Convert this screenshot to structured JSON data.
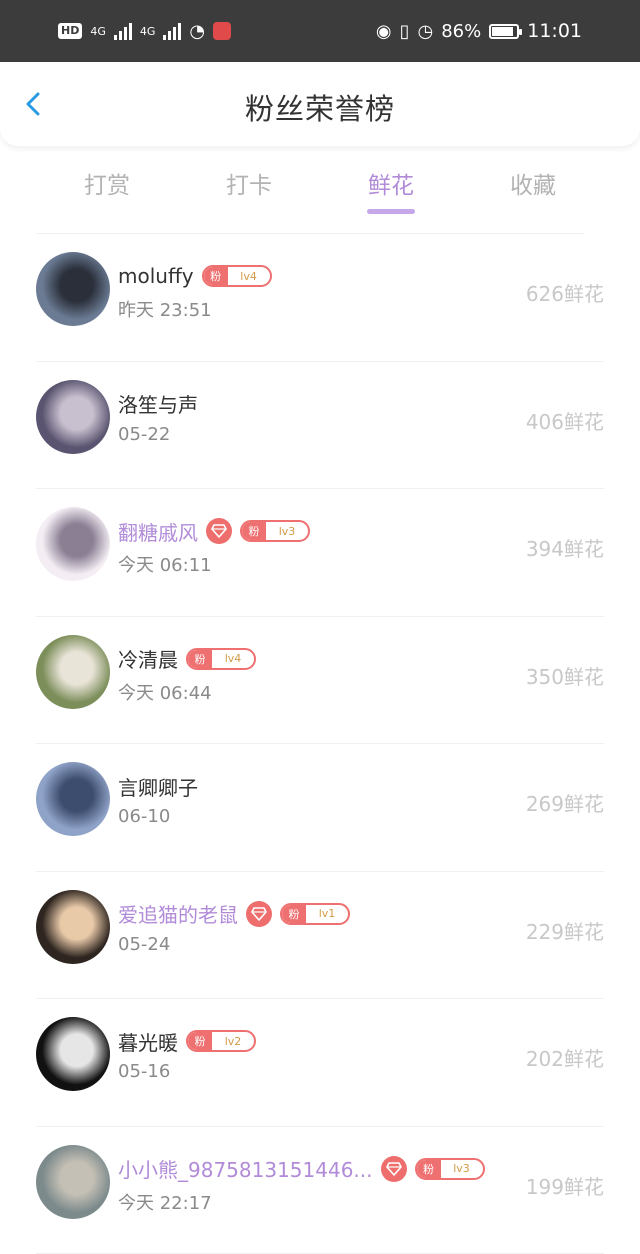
{
  "status_bar": {
    "hd": "HD",
    "net1": "4G",
    "net2": "4G",
    "battery": "86%",
    "time": "11:01"
  },
  "header": {
    "title": "粉丝荣誉榜"
  },
  "tabs": [
    {
      "label": "打赏",
      "active": false
    },
    {
      "label": "打卡",
      "active": false
    },
    {
      "label": "鲜花",
      "active": true
    },
    {
      "label": "收藏",
      "active": false
    }
  ],
  "fans_list": [
    {
      "name": "moluffy",
      "vip": false,
      "diamond": false,
      "badge_fan": "粉",
      "badge_level": "lv4",
      "time": "昨天 23:51",
      "amount": "626鲜花",
      "avatar_colors": [
        "#6b7b93",
        "#2a2f3a"
      ]
    },
    {
      "name": "洛笙与声",
      "vip": false,
      "diamond": false,
      "badge_fan": "",
      "badge_level": "",
      "time": "05-22",
      "amount": "406鲜花",
      "avatar_colors": [
        "#5a5470",
        "#c9c0cf"
      ]
    },
    {
      "name": "翻糖戚风",
      "vip": true,
      "diamond": true,
      "badge_fan": "粉",
      "badge_level": "lv3",
      "time": "今天 06:11",
      "amount": "394鲜花",
      "avatar_colors": [
        "#f4eef4",
        "#8b7f94"
      ]
    },
    {
      "name": "冷清晨",
      "vip": false,
      "diamond": false,
      "badge_fan": "粉",
      "badge_level": "lv4",
      "time": "今天 06:44",
      "amount": "350鲜花",
      "avatar_colors": [
        "#7c8e5a",
        "#e9e4d8"
      ]
    },
    {
      "name": "言卿卿子",
      "vip": false,
      "diamond": false,
      "badge_fan": "",
      "badge_level": "",
      "time": "06-10",
      "amount": "269鲜花",
      "avatar_colors": [
        "#8fa2c7",
        "#3d4d6e"
      ]
    },
    {
      "name": "爱追猫的老鼠",
      "vip": true,
      "diamond": true,
      "badge_fan": "粉",
      "badge_level": "lv1",
      "time": "05-24",
      "amount": "229鲜花",
      "avatar_colors": [
        "#2e2520",
        "#e8c9a8"
      ]
    },
    {
      "name": "暮光暖",
      "vip": false,
      "diamond": false,
      "badge_fan": "粉",
      "badge_level": "lv2",
      "time": "05-16",
      "amount": "202鲜花",
      "avatar_colors": [
        "#111111",
        "#e6e6e6"
      ]
    },
    {
      "name": "小小熊_9875813151446...",
      "vip": true,
      "diamond": true,
      "badge_fan": "粉",
      "badge_level": "lv3",
      "time": "今天 22:17",
      "amount": "199鲜花",
      "avatar_colors": [
        "#7c8a8c",
        "#c5c0b5"
      ]
    }
  ],
  "colors": {
    "accent": "#b18bd8",
    "badge": "#ee7070",
    "level_text": "#d49a45"
  }
}
